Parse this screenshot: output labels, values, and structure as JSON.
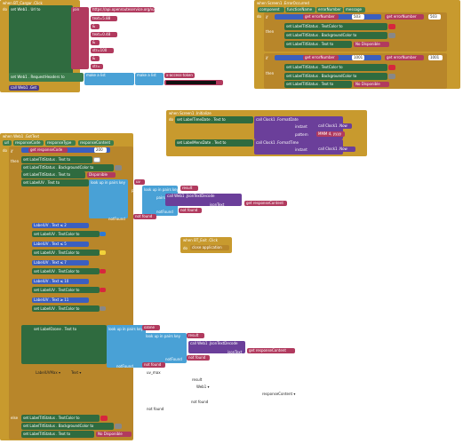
{
  "left_event": {
    "header": "when BT_Cargar .Click",
    "do": "do",
    "set_url": "set Web1 . Url to",
    "join": "join",
    "url_base": "https://api.openrouteservice.org/v2/",
    "t1": "text=5.88",
    "t2": "&",
    "t3": "text=0.48",
    "t4": "&",
    "t5": "str=100",
    "t6": "&",
    "t7": "str=",
    "set_headers": "set Web1 . RequestHeaders to",
    "make_list1": "make a list",
    "make_list2": "make a list",
    "item_key": "x-access-token",
    "call_get": "call Web1 .Get"
  },
  "error_event": {
    "header": "when Screen1 .ErrorOccurred",
    "params": [
      "component",
      "functionName",
      "errorNumber",
      "message"
    ],
    "do": "do",
    "if": "if",
    "then": "then",
    "cond1": "get errorNumber = 503",
    "cond1_val": "503",
    "cond1_get": "get errorNumber",
    "set1": "set LabelTitStatus . TextColor to",
    "set2": "set LabelTitStatus . BackgroundColor to",
    "set3": "set LabelTitStatus . Text to",
    "text_nodisp": "No Disponible",
    "cond2": "get errorNumber = 1001",
    "cond2_val": "1001",
    "cond2_get": "get errorNumber",
    "set4": "set LabelTitStatus . TextColor to",
    "set5": "set LabelTitStatus . BackgroundColor to",
    "set6": "set LabelTitStatus . Text to",
    "text_nodisp2": "No Disponible"
  },
  "init_event": {
    "header": "when Screen1 .Initialize",
    "do": "do",
    "set_date": "set LabelTimeDate . Text to",
    "call_fmt_date": "call Clock1 .FormatDate",
    "instant1": "instant",
    "call_now1": "call Clock1 .Now",
    "pattern": "pattern",
    "pattern_val": "MMM d, yyyy",
    "set_time": "set LabelMensDate . Text to",
    "call_fmt_time": "call Clock1 .FormatTime",
    "instant2": "instant",
    "call_now2": "call Clock1 .Now"
  },
  "exit_event": {
    "header": "when BT_Exit .Click",
    "do": "do",
    "close": "close application"
  },
  "gottext_event": {
    "header": "when Web1 .GotText",
    "params": [
      "url",
      "responseCode",
      "responseType",
      "responseContent"
    ],
    "do": "do",
    "if": "if",
    "then": "then",
    "else": "else",
    "cond_main": "get responseCode = 200",
    "cond_main_get": "get responseCode",
    "cond_main_val": "200",
    "s1": "set LabelTitStatus . Text to",
    "s2": "set LabelTitStatus . BackgroundColor to",
    "s3": "set LabelTitStatus . Text to",
    "s3_val": "Disponible",
    "s4": "set LabelUV . Text to",
    "lookup1": "look up in pairs key",
    "key_uv": "uv",
    "pairs": "pairs",
    "lookup2": "look up in pairs key",
    "key_result": "result",
    "pairs2": "pairs",
    "json_decode": "call Web1 .JsonTextDecode",
    "json_text": "jsonText",
    "get_content": "get responseContent",
    "not_found1": "notFound",
    "not_found1_val": "not found",
    "not_found2": "notFound",
    "not_found2_val": "not found",
    "uv_checks": [
      {
        "cmp": "LabelUV . Text ≤ 2",
        "set": "set LabelUV . TextColor to"
      },
      {
        "cmp": "LabelUV . Text ≤ 5",
        "set": "set LabelUV . TextColor to"
      },
      {
        "cmp": "LabelUV . Text ≤ 7",
        "set": "set LabelUV . TextColor to"
      },
      {
        "cmp": "LabelUV . Text ≤ 10",
        "set": "set LabelUV . TextColor to"
      },
      {
        "cmp": "LabelUV . Text ≥ 11",
        "set": "set LabelUV . TextColor to"
      }
    ],
    "s_ozone": "set LabelOzone . Text to",
    "lookup3": "look up in pairs key",
    "key_ozone": "ozone",
    "lookup4": "look up in pairs key",
    "key_result2": "result",
    "json_decode2": "call Web1 .JsonTextDecode",
    "json_text2": "jsonText",
    "get_content2": "get responseContent",
    "not_found3": "notFound",
    "not_found3_val": "not found",
    "not_found4": "notFound",
    "not_found4_val": "not found",
    "dangling": {
      "label_uv_max": "LabelUVMax ▾",
      "text": "Text ▾",
      "uv_max": "uv_max",
      "result": "result",
      "web1": "Web1 ▾",
      "response_content": "responseContent ▾",
      "not_found_a": "not found",
      "not_found_b": "not found"
    },
    "e1": "set LabelTitStatus . TextColor to",
    "e2": "set LabelTitStatus . BackgroundColor to",
    "e3": "set LabelTitStatus . Text to",
    "e3_val": "No Disponible"
  },
  "colors": {
    "event": "#c89a2e",
    "set": "#2f6b3f",
    "text": "#b13a5e",
    "list": "#49a1d6",
    "call": "#6b3f9a"
  }
}
